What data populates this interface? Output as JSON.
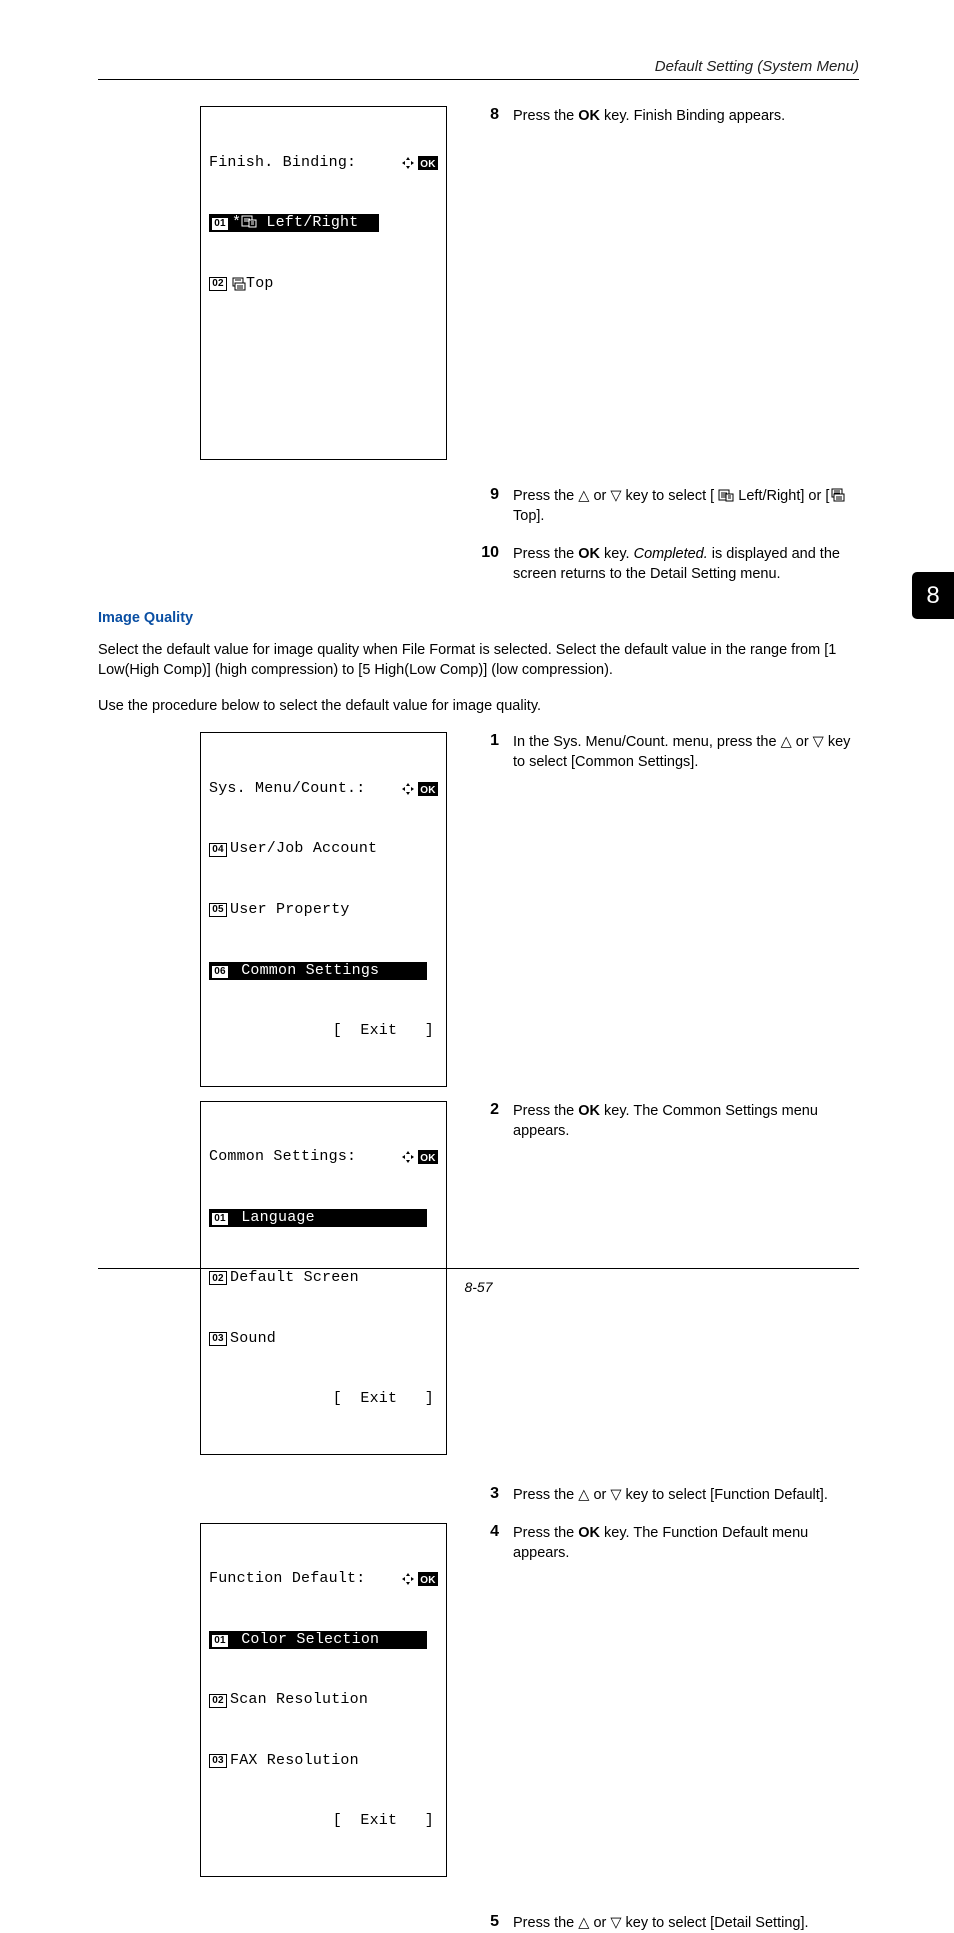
{
  "header": "Default Setting (System Menu)",
  "sideTab": "8",
  "pageNumber": "8-57",
  "lcd1": {
    "title": "Finish. Binding:",
    "row1_num": "01",
    "row1_text": " Left/Right",
    "row2_num": "02",
    "row2_text": "Top"
  },
  "steps_top": {
    "s8": {
      "n": "8",
      "t": "Press the <b>OK</b> key. Finish Binding appears."
    },
    "s9": {
      "n": "9",
      "t": "Press the &#9651; or &#9661; key to select [ <svg class='mini-icon' viewBox='0 0 16 14'><rect x='1' y='2' width='10' height='10' fill='none' stroke='black'/><line x1='3' y1='5' x2='9' y2='5' stroke='black'/><line x1='3' y1='7' x2='9' y2='7' stroke='black'/><line x1='3' y1='9' x2='9' y2='9' stroke='black'/><rect x='8' y='6' width='7' height='7' fill='white' stroke='black'/><line x1='10' y1='8' x2='13' y2='8' stroke='black'/><line x1='10' y1='10' x2='13' y2='10' stroke='black'/></svg> Left/Right] or [<svg class='mini-icon' viewBox='0 0 16 14'><rect x='3' y='1' width='10' height='8' fill='none' stroke='black'/><line x1='5' y1='3' x2='11' y2='3' stroke='black'/><line x1='5' y1='5' x2='11' y2='5' stroke='black'/><rect x='5' y='6' width='10' height='7' fill='white' stroke='black'/><line x1='7' y1='9' x2='13' y2='9' stroke='black'/><line x1='7' y1='11' x2='13' y2='11' stroke='black'/></svg> Top]."
    },
    "s10": {
      "n": "10",
      "t": "Press the <b>OK</b> key. <i>Completed.</i> is displayed and the screen returns to the Detail Setting menu."
    }
  },
  "section": {
    "title": "Image Quality",
    "p1": "Select the default value for image quality when File Format is selected. Select the default value in the range from [1 Low(High Comp)] (high compression) to [5 High(Low Comp)] (low compression).",
    "p2": "Use the procedure below to select the default value for image quality."
  },
  "lcd2": {
    "title": "Sys. Menu/Count.:",
    "r1_num": "04",
    "r1_text": "User/Job Account",
    "r2_num": "05",
    "r2_text": "User Property",
    "r3_num": "06",
    "r3_text": "Common Settings",
    "exit": "[  Exit   ]"
  },
  "lcd3": {
    "title": "Common Settings:",
    "r1_num": "01",
    "r1_text": "Language",
    "r2_num": "02",
    "r2_text": "Default Screen",
    "r3_num": "03",
    "r3_text": "Sound",
    "exit": "[  Exit   ]"
  },
  "lcd4": {
    "title": "Function Default:",
    "r1_num": "01",
    "r1_text": "Color Selection",
    "r2_num": "02",
    "r2_text": "Scan Resolution",
    "r3_num": "03",
    "r3_text": "FAX Resolution",
    "exit": "[  Exit   ]"
  },
  "steps_b": {
    "s1": {
      "n": "1",
      "t": "In the Sys. Menu/Count. menu, press the &#9651; or &#9661; key to select [Common Settings]."
    },
    "s2": {
      "n": "2",
      "t": "Press the <b>OK</b> key. The Common Settings menu appears."
    },
    "s3": {
      "n": "3",
      "t": "Press the &#9651; or &#9661; key to select [Function Default]."
    },
    "s4": {
      "n": "4",
      "t": "Press the <b>OK</b> key. The Function Default menu appears."
    },
    "s5": {
      "n": "5",
      "t": "Press the &#9651; or &#9661; key to select [Detail Setting]."
    }
  }
}
